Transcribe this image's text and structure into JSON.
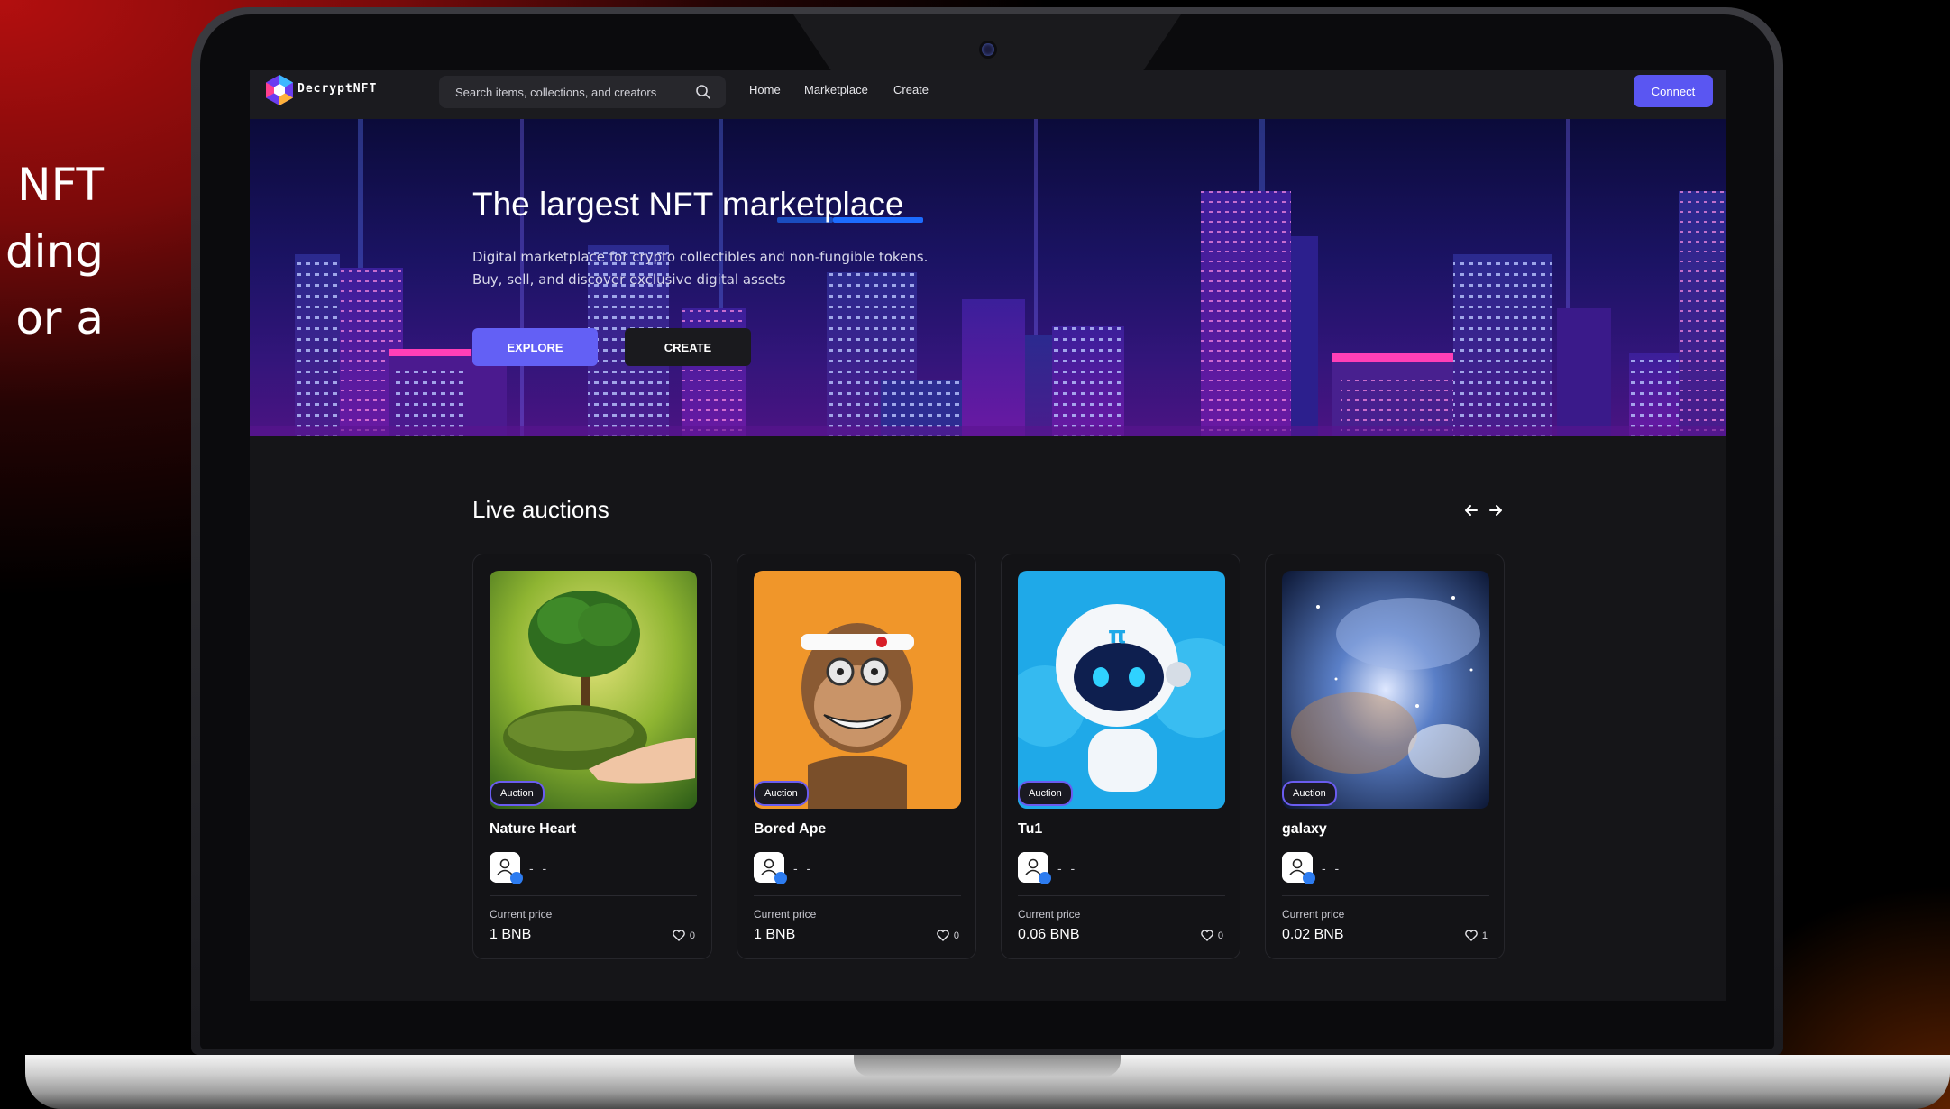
{
  "side_text": [
    "NFT",
    "ding",
    "or  a"
  ],
  "app": {
    "logo_text": "DecryptNFT",
    "search_placeholder": "Search items, collections, and creators",
    "nav_links": [
      "Home",
      "Marketplace",
      "Create"
    ],
    "connect_label": "Connect"
  },
  "hero": {
    "title": "The largest NFT marketplace",
    "subtitle_line1": "Digital marketplace for crypto collectibles and non-fungible tokens.",
    "subtitle_line2": "Buy, sell, and discover exclusive digital assets",
    "explore_label": "EXPLORE",
    "create_label": "CREATE"
  },
  "auctions": {
    "title": "Live auctions",
    "items": [
      {
        "badge": "Auction",
        "name": "Nature Heart",
        "creator": "- -",
        "price_label": "Current price",
        "price": "1 BNB",
        "likes": "0"
      },
      {
        "badge": "Auction",
        "name": "Bored Ape",
        "creator": "- -",
        "price_label": "Current price",
        "price": "1 BNB",
        "likes": "0"
      },
      {
        "badge": "Auction",
        "name": "Tu1",
        "creator": "- -",
        "price_label": "Current price",
        "price": "0.06 BNB",
        "likes": "0"
      },
      {
        "badge": "Auction",
        "name": "galaxy",
        "creator": "- -",
        "price_label": "Current price",
        "price": "0.02 BNB",
        "likes": "1"
      }
    ]
  },
  "colors": {
    "accent": "#5a56f2",
    "background": "#151518",
    "verified": "#2d7cf0"
  }
}
